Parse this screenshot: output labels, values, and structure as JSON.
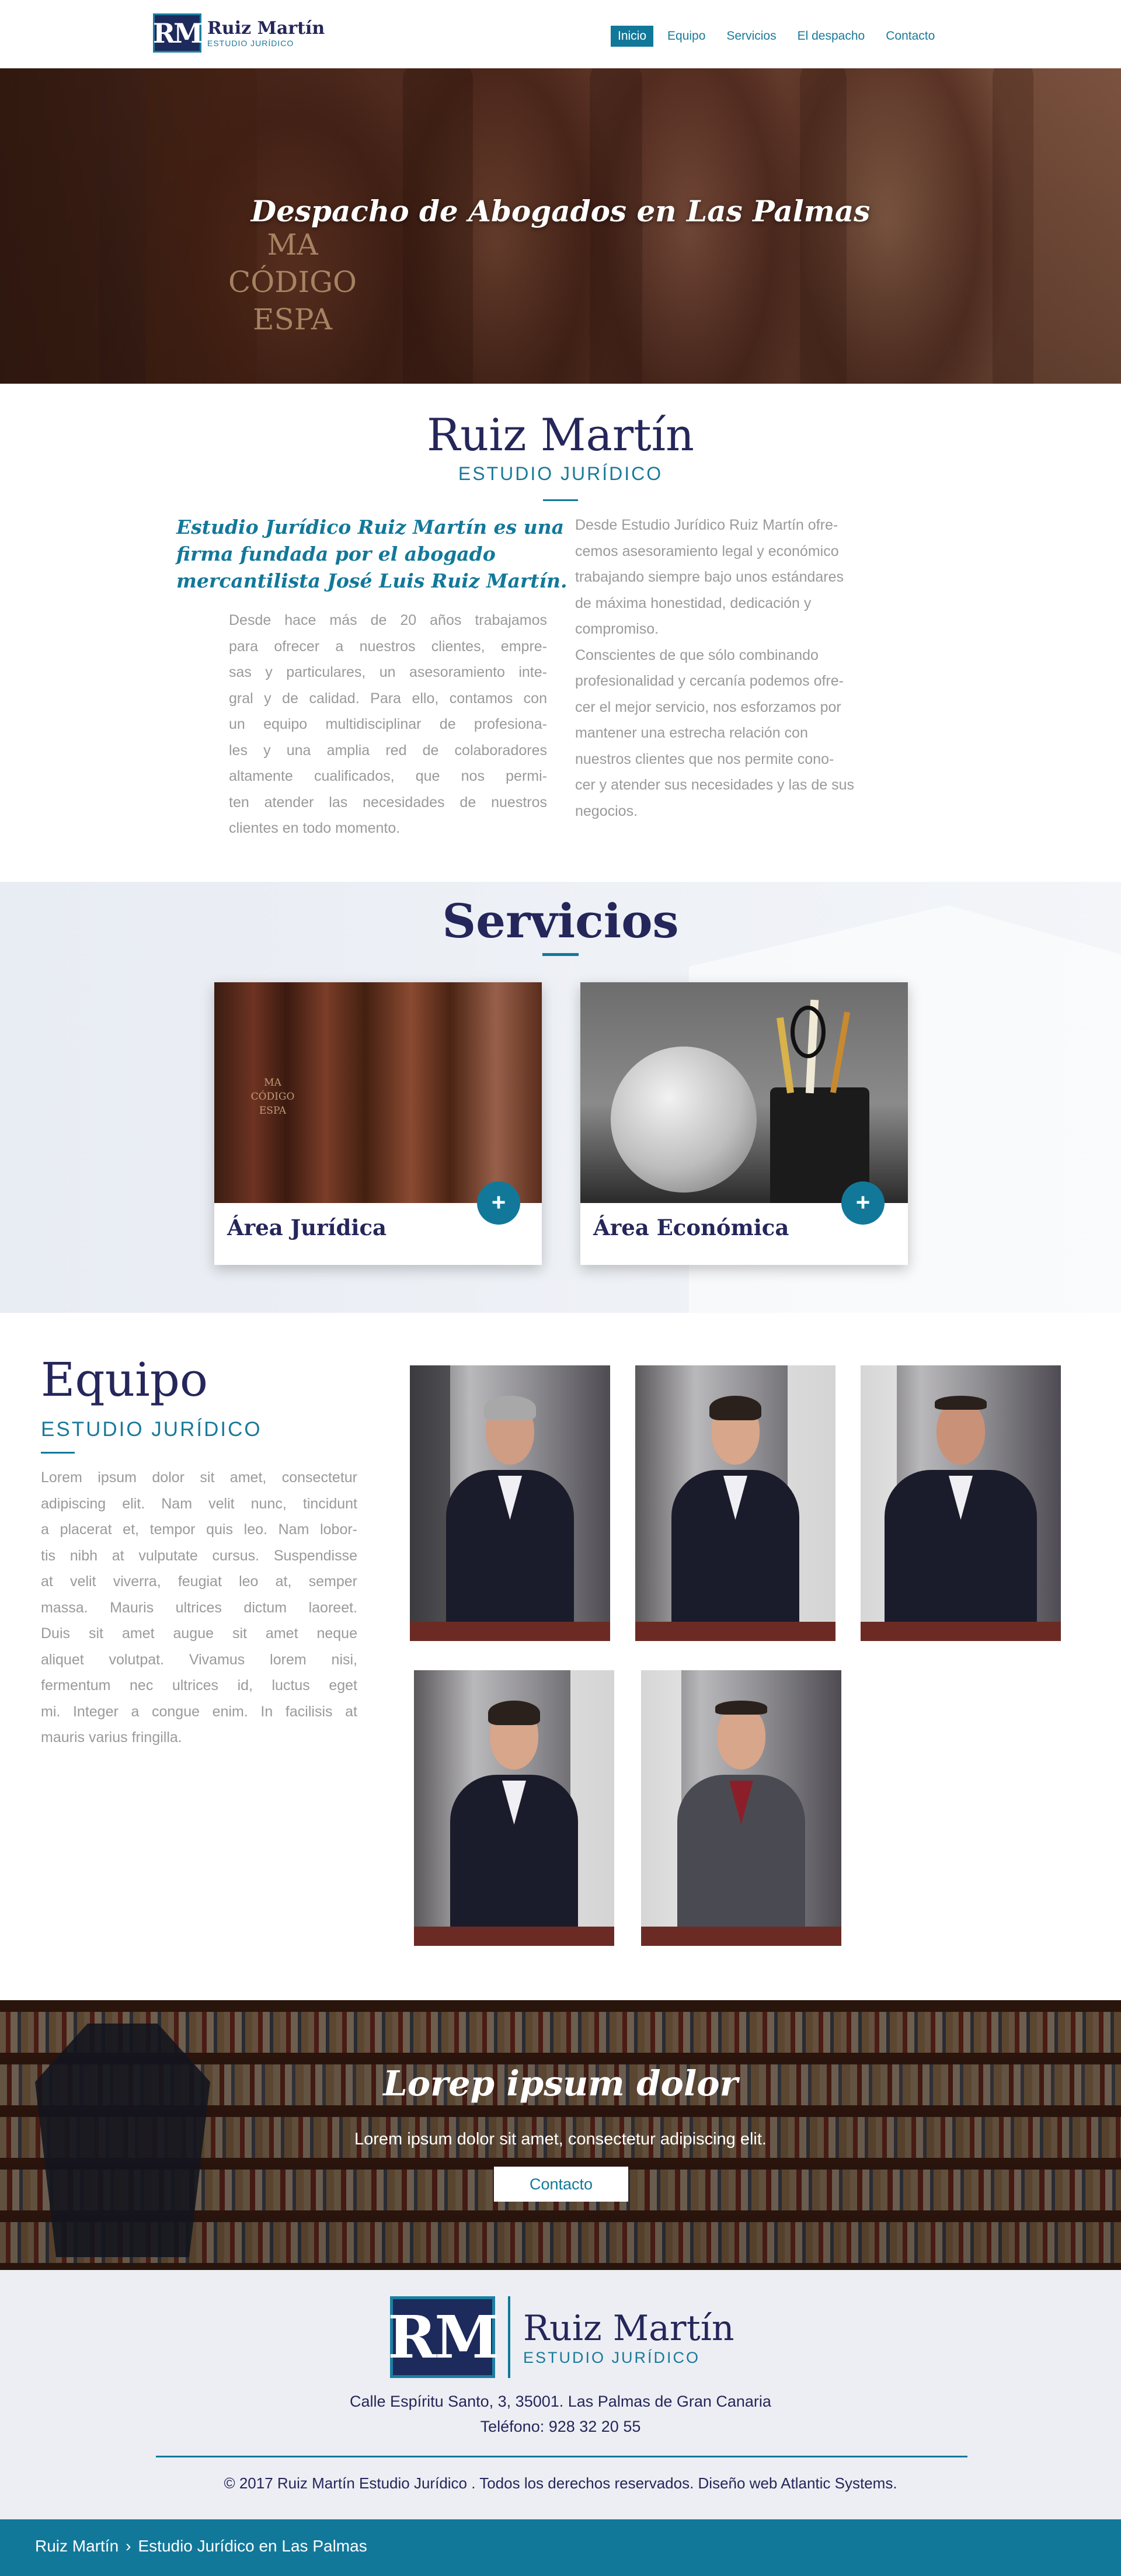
{
  "header": {
    "logo_mark": "RM",
    "logo_name": "Ruiz Martín",
    "logo_sub": "ESTUDIO JURÍDICO",
    "nav": [
      {
        "label": "Inicio",
        "active": true
      },
      {
        "label": "Equipo",
        "active": false
      },
      {
        "label": "Servicios",
        "active": false
      },
      {
        "label": "El despacho",
        "active": false
      },
      {
        "label": "Contacto",
        "active": false
      }
    ]
  },
  "hero": {
    "title": "Despacho de Abogados en Las Palmas",
    "book_text": [
      "MA",
      "CÓDIGO",
      "ESPA"
    ]
  },
  "intro": {
    "title": "Ruiz Martín",
    "subtitle": "ESTUDIO JURÍDICO",
    "lead": [
      "Estudio Jurídico Ruiz Martín es una",
      "firma fundada por el abogado",
      "mercantilista José Luis Ruiz Martín."
    ],
    "left_paragraph": [
      "Desde hace más de 20 años trabajamos",
      "para ofrecer a nuestros clientes, empre-",
      "sas y particulares, un asesoramiento inte-",
      "gral y de calidad. Para ello, contamos con",
      "un equipo multidisciplinar de profesiona-",
      "les y una amplia red de colaboradores",
      "altamente cualificados, que nos permi-",
      "ten atender las necesidades de nuestros",
      "clientes en todo momento."
    ],
    "right_paragraph": [
      "Desde Estudio Jurídico Ruiz Martín ofre-",
      "cemos asesoramiento legal y económico",
      "trabajando siempre bajo unos estándares",
      "de máxima honestidad, dedicación y",
      "compromiso.",
      "Conscientes de que sólo combinando",
      "profesionalidad y cercanía podemos ofre-",
      "cer el mejor servicio, nos esforzamos por",
      "mantener una estrecha relación con",
      "nuestros clientes que nos permite cono-",
      "cer y atender sus necesidades y las de sus",
      "negocios."
    ]
  },
  "services": {
    "title": "Servicios",
    "cards": [
      {
        "title": "Área Jurídica",
        "plus": "+",
        "image": "law-books"
      },
      {
        "title": "Área Económica",
        "plus": "+",
        "image": "globe-and-pens"
      }
    ]
  },
  "team": {
    "title": "Equipo",
    "subtitle": "ESTUDIO JURÍDICO",
    "text": [
      "Lorem ipsum dolor sit amet, consectetur",
      "adipiscing elit. Nam velit nunc, tincidunt",
      "a placerat et, tempor quis leo. Nam lobor-",
      "tis nibh at vulputate cursus. Suspendisse",
      "at velit viverra, feugiat leo at, semper",
      "massa. Mauris ultrices dictum laoreet.",
      "Duis sit amet augue sit amet neque",
      "aliquet volutpat. Vivamus lorem nisi,",
      "fermentum nec ultrices id, luctus eget",
      "mi. Integer a congue enim. In facilisis at",
      "mauris varius fringilla."
    ],
    "photos": [
      "team-member-1",
      "team-member-2",
      "team-member-3",
      "team-member-4",
      "team-member-5"
    ]
  },
  "cta": {
    "title": "Lorep ipsum dolor",
    "subtitle": "Lorem ipsum dolor sit amet, consectetur adipiscing elit.",
    "button": "Contacto"
  },
  "footer": {
    "logo_mark": "RM",
    "logo_name": "Ruiz Martín",
    "logo_sub": "ESTUDIO JURÍDICO",
    "address": "Calle Espíritu Santo, 3, 35001. Las Palmas de Gran Canaria",
    "phone": "Teléfono: 928 32 20 55",
    "copyright": "© 2017 Ruiz Martín Estudio Jurídico . Todos los derechos reservados. Diseño web Atlantic Systems."
  },
  "breadcrumb": {
    "home": "Ruiz Martín",
    "separator": "›",
    "current": "Estudio Jurídico en Las Palmas"
  },
  "colors": {
    "accent": "#12789a",
    "navy": "#25265a",
    "body_text": "#9a9a9a",
    "footer_bg": "#eceef3"
  }
}
